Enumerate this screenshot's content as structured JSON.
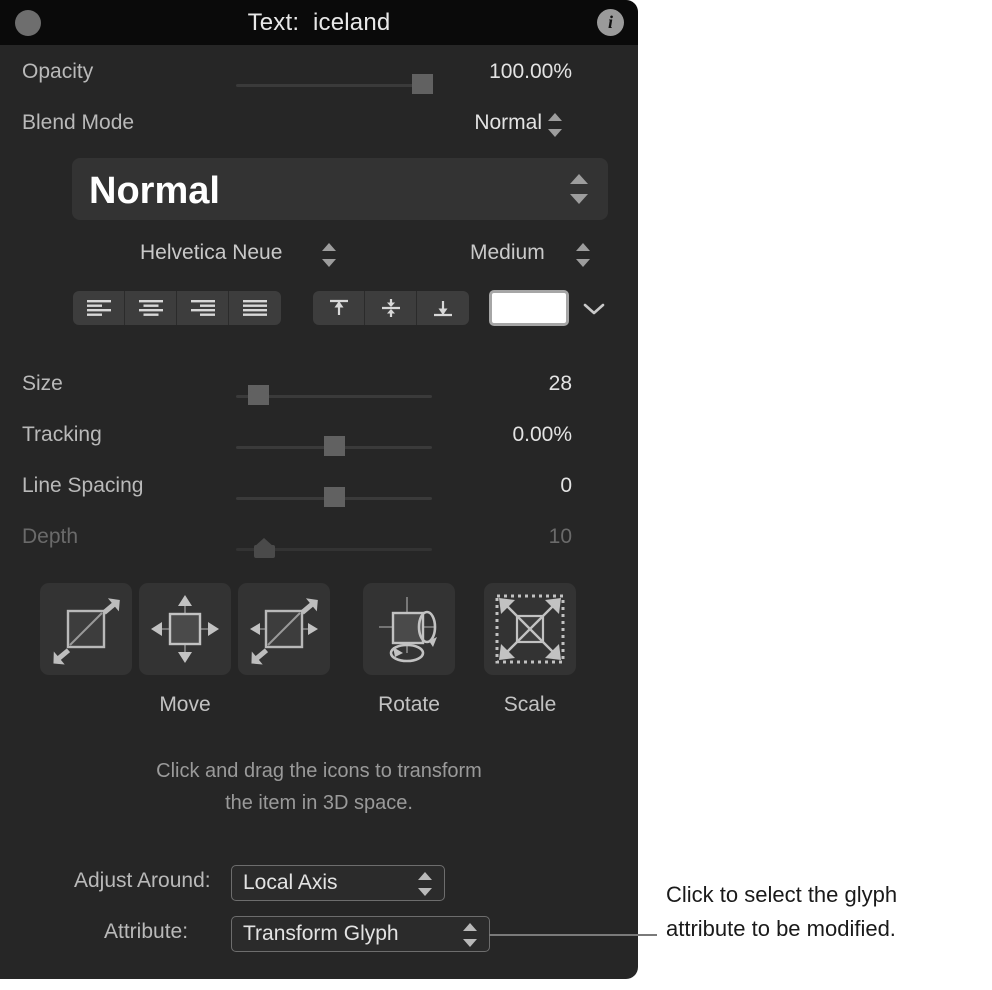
{
  "window": {
    "title": "Text:  iceland",
    "close_button": "",
    "info_button": "i"
  },
  "opacity": {
    "label": "Opacity",
    "value": "100.00%"
  },
  "blend_mode": {
    "label": "Blend Mode",
    "value": "Normal",
    "popup_value": "Normal"
  },
  "font": {
    "family": "Helvetica Neue",
    "weight": "Medium"
  },
  "alignment": {
    "horizontal": [
      "align-left",
      "align-center",
      "align-right",
      "align-justify"
    ],
    "vertical": [
      "align-top",
      "align-middle",
      "align-bottom"
    ]
  },
  "color": {
    "swatch_hex": "#ffffff",
    "disclosure": "chevron-down"
  },
  "sliders": [
    {
      "label": "Size",
      "value": "28",
      "pos": 0.12,
      "disabled": false
    },
    {
      "label": "Tracking",
      "value": "0.00%",
      "pos": 0.5,
      "disabled": false
    },
    {
      "label": "Line Spacing",
      "value": "0",
      "pos": 0.5,
      "disabled": false
    },
    {
      "label": "Depth",
      "value": "10",
      "pos": 0.15,
      "disabled": true
    }
  ],
  "transform": {
    "buttons": [
      {
        "name": "move-plane-xy-icon"
      },
      {
        "name": "move-arrows-icon"
      },
      {
        "name": "move-plane-z-icon"
      },
      {
        "name": "rotate-icon"
      },
      {
        "name": "scale-icon"
      }
    ],
    "captions": {
      "move": "Move",
      "rotate": "Rotate",
      "scale": "Scale"
    },
    "hint_line1": "Click and drag the icons to transform",
    "hint_line2": "the item in 3D space."
  },
  "adjust_around": {
    "label": "Adjust Around:",
    "value": "Local Axis"
  },
  "attribute": {
    "label": "Attribute:",
    "value": "Transform Glyph"
  },
  "callout": {
    "text": "Click to select the glyph\nattribute to be modified."
  },
  "theme": {
    "panel_bg": "#262626",
    "titlebar_bg": "#0a0a0a",
    "label_color": "#b9b9b9",
    "value_color": "#e3e3e3",
    "accent_white": "#ffffff"
  }
}
